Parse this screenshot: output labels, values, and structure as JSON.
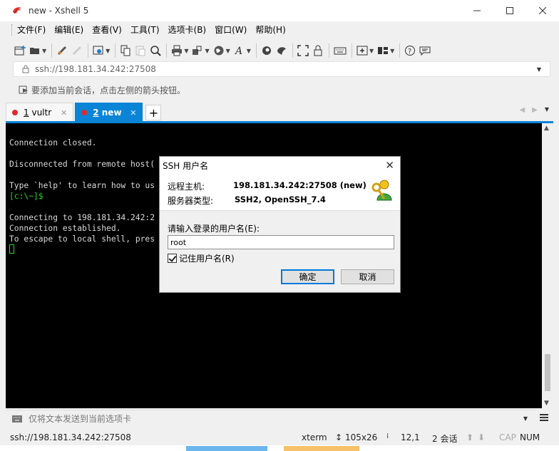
{
  "window": {
    "title": "new - Xshell 5"
  },
  "menu": [
    "文件(F)",
    "编辑(E)",
    "查看(V)",
    "工具(T)",
    "选项卡(B)",
    "窗口(W)",
    "帮助(H)"
  ],
  "address": {
    "value": "ssh://198.181.34.242:27508"
  },
  "linkbar": {
    "hint": "要添加当前会话，点击左侧的箭头按钮。"
  },
  "tabs": [
    {
      "num": "1",
      "name": "vultr",
      "active": false
    },
    {
      "num": "2",
      "name": "new",
      "active": true
    }
  ],
  "terminal": {
    "lines": [
      {
        "text": "Connection closed.",
        "green": false
      },
      {
        "text": "",
        "green": false
      },
      {
        "text": "Disconnected from remote host(",
        "green": false
      },
      {
        "text": "",
        "green": false
      },
      {
        "text": "Type `help' to learn how to us",
        "green": false
      },
      {
        "text": "[c:\\~]$",
        "green": true
      },
      {
        "text": "",
        "green": false
      },
      {
        "text": "Connecting to 198.181.34.242:2",
        "green": false
      },
      {
        "text": "Connection established.",
        "green": false
      },
      {
        "text": "To escape to local shell, pres",
        "green": false
      }
    ]
  },
  "sendbar": {
    "hint": "仅将文本发送到当前选项卡"
  },
  "status": {
    "session": "ssh://198.181.34.242:27508",
    "term": "xterm",
    "size": "105x26",
    "pos": "12,1",
    "sessions": "2 会话",
    "cap": "CAP",
    "num": "NUM"
  },
  "dialog": {
    "title": "SSH 用户名",
    "host_label": "远程主机:",
    "host_value": "198.181.34.242:27508 (new)",
    "server_label": "服务器类型:",
    "server_value": "SSH2, OpenSSH_7.4",
    "prompt": "请输入登录的用户名(E):",
    "username": "root",
    "remember": "记住用户名(R)",
    "ok": "确定",
    "cancel": "取消"
  }
}
